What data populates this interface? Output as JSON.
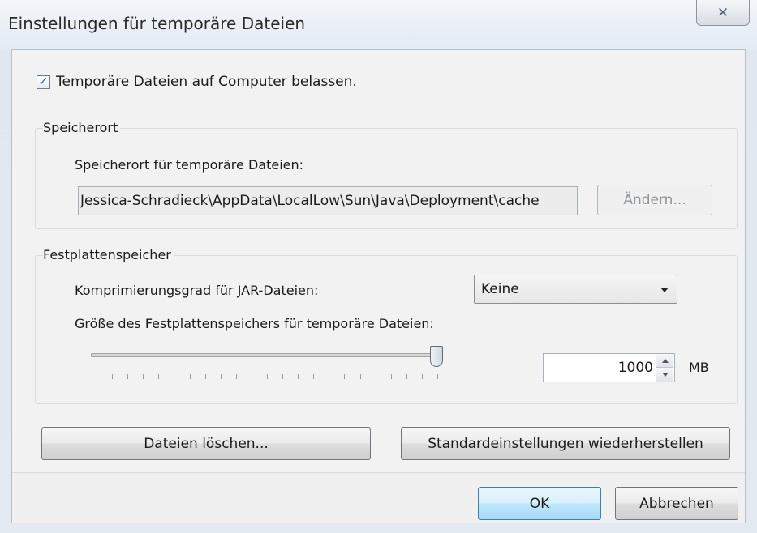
{
  "window": {
    "title": "Einstellungen für temporäre Dateien",
    "close_glyph": "✕"
  },
  "keep_files": {
    "checked": true,
    "check_glyph": "✓",
    "label": "Temporäre Dateien auf Computer belassen."
  },
  "location": {
    "group_title": "Speicherort",
    "label": "Speicherort für temporäre Dateien:",
    "path": "Jessica-Schradieck\\AppData\\LocalLow\\Sun\\Java\\Deployment\\cache",
    "change_button": "Ändern..."
  },
  "disk": {
    "group_title": "Festplattenspeicher",
    "compression_label": "Komprimierungsgrad für JAR-Dateien:",
    "compression_value": "Keine",
    "size_label": "Größe des Festplattenspeichers für temporäre Dateien:",
    "slider_fraction": 1.0,
    "size_value": "1000",
    "unit": "MB"
  },
  "actions": {
    "delete_files": "Dateien löschen...",
    "restore_defaults": "Standardeinstellungen wiederherstellen"
  },
  "footer": {
    "ok": "OK",
    "cancel": "Abbrechen"
  },
  "colors": {
    "ok_accent": "#3c7fb1",
    "check_color": "#2a57a8"
  },
  "icons": {
    "close": "close-icon",
    "dropdown": "chevron-down-icon",
    "spin_up": "spin-up-icon",
    "spin_down": "spin-down-icon"
  }
}
